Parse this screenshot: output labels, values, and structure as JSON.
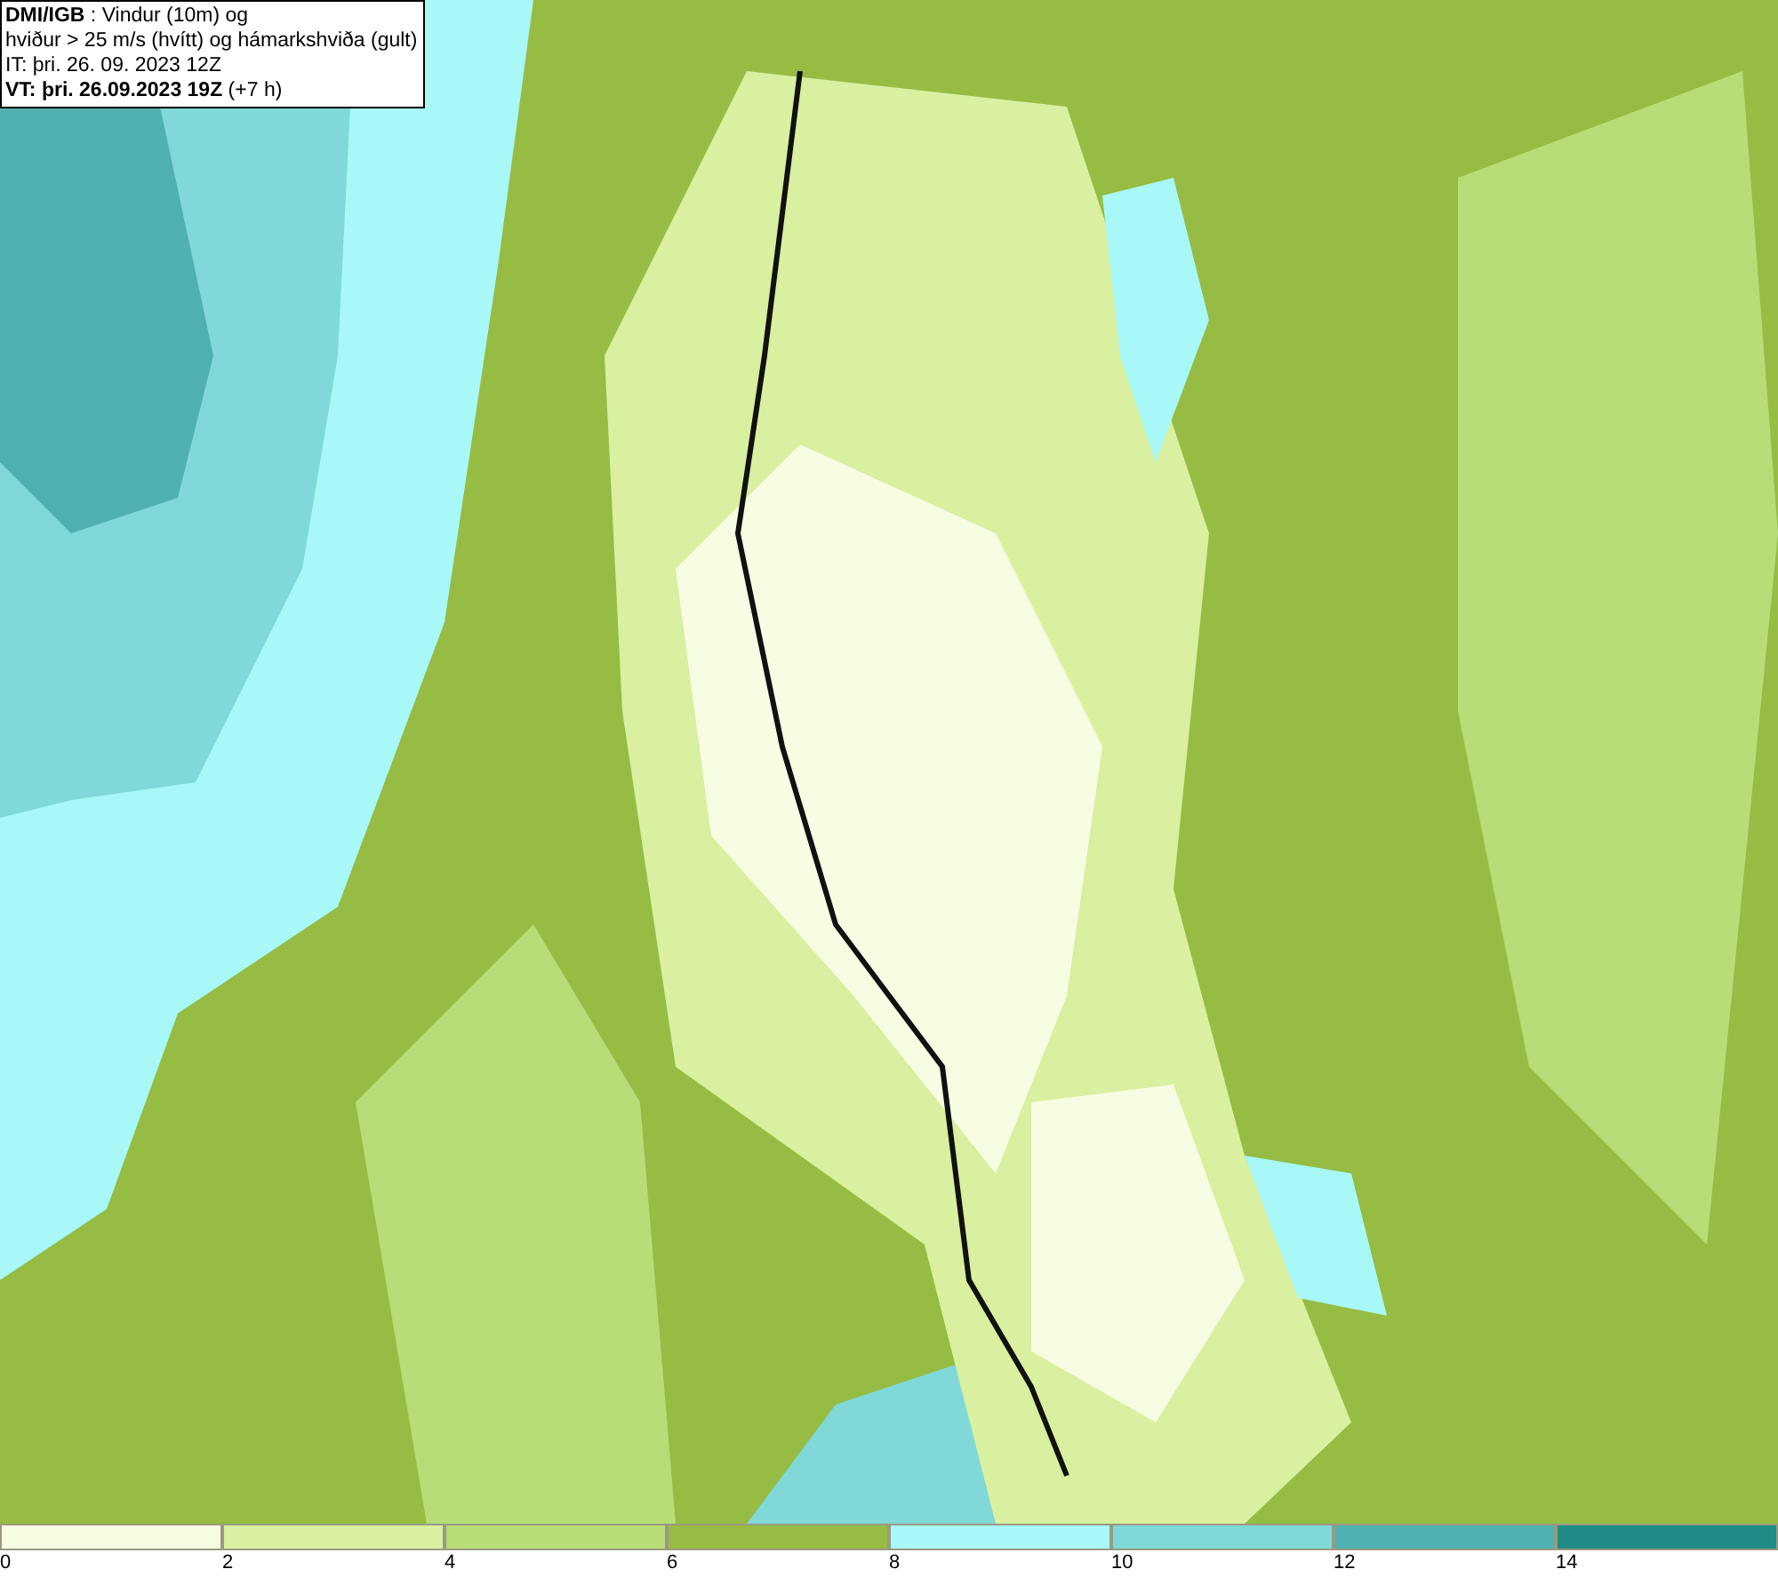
{
  "header": {
    "lines": [
      "**DMI/IGB** : Vindur (10m) og",
      "hviður > 25 m/s (hvítt) og hámarkshviða (gult)",
      "IT: þri. 26. 09. 2023 12Z",
      "**VT: þri. 26.09.2023 19Z** (+7 h)"
    ]
  },
  "legend": {
    "bins": [
      {
        "color": "#f7fde3",
        "label": "0"
      },
      {
        "color": "#d8f0a0",
        "label": "2"
      },
      {
        "color": "#b8dc78",
        "label": "4"
      },
      {
        "color": "#96bc44",
        "label": "6"
      },
      {
        "color": "#a8f8f8",
        "label": "8"
      },
      {
        "color": "#80d8d8",
        "label": "10"
      },
      {
        "color": "#50b0b0",
        "label": "12"
      },
      {
        "color": "#208c88",
        "label": "14"
      }
    ]
  }
}
